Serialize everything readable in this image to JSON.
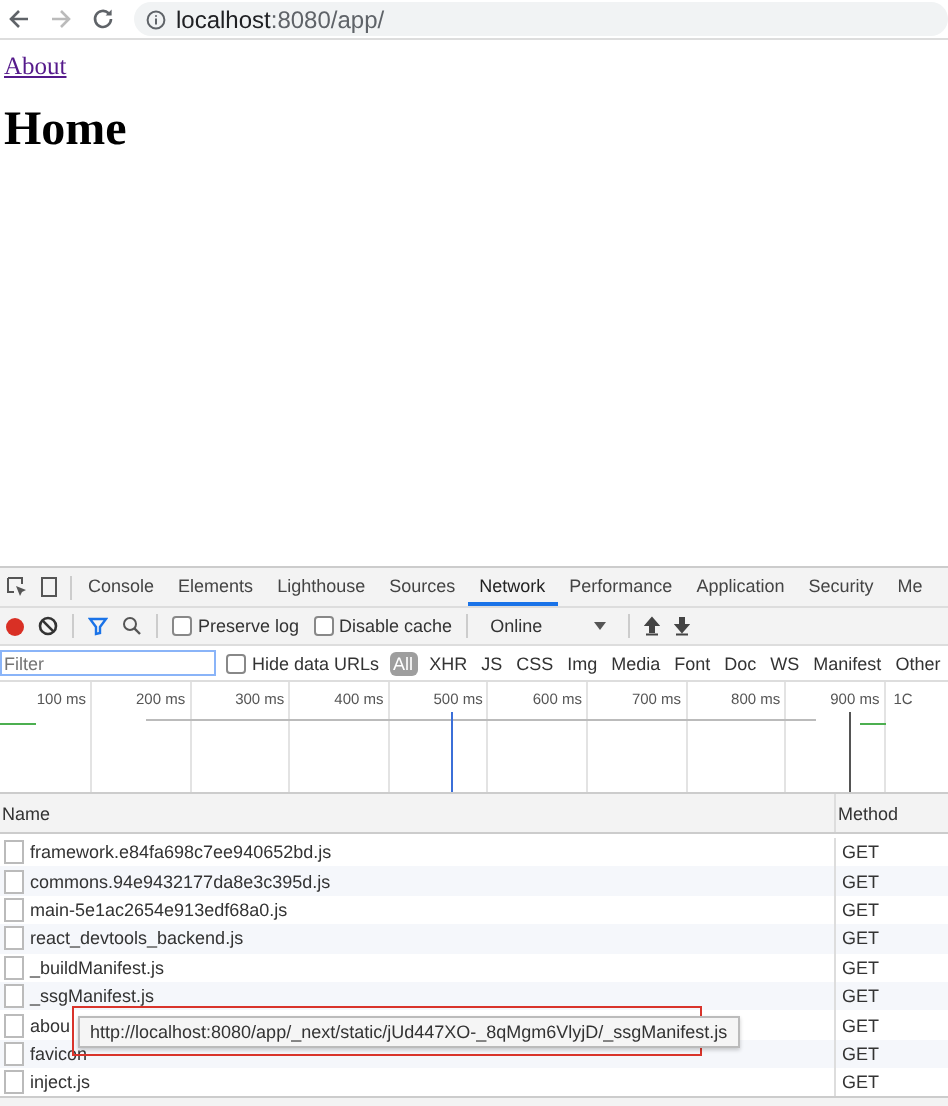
{
  "browser": {
    "url_host": "localhost",
    "url_rest": ":8080/app/"
  },
  "page": {
    "link": "About",
    "heading": "Home"
  },
  "devtools": {
    "tabs": [
      {
        "label": "Console",
        "selected": false
      },
      {
        "label": "Elements",
        "selected": false
      },
      {
        "label": "Lighthouse",
        "selected": false
      },
      {
        "label": "Sources",
        "selected": false
      },
      {
        "label": "Network",
        "selected": true
      },
      {
        "label": "Performance",
        "selected": false
      },
      {
        "label": "Application",
        "selected": false
      },
      {
        "label": "Security",
        "selected": false
      },
      {
        "label": "Me",
        "selected": false
      }
    ],
    "toolbar": {
      "recording": true,
      "preserve_log": {
        "label": "Preserve log",
        "checked": false
      },
      "disable_cache": {
        "label": "Disable cache",
        "checked": false
      },
      "throttling": "Online"
    },
    "filter": {
      "placeholder": "Filter",
      "hide_data_urls": {
        "label": "Hide data URLs",
        "checked": false
      },
      "types": [
        {
          "label": "All",
          "selected": true
        },
        {
          "label": "XHR",
          "selected": false
        },
        {
          "label": "JS",
          "selected": false
        },
        {
          "label": "CSS",
          "selected": false
        },
        {
          "label": "Img",
          "selected": false
        },
        {
          "label": "Media",
          "selected": false
        },
        {
          "label": "Font",
          "selected": false
        },
        {
          "label": "Doc",
          "selected": false
        },
        {
          "label": "WS",
          "selected": false
        },
        {
          "label": "Manifest",
          "selected": false
        },
        {
          "label": "Other",
          "selected": false
        }
      ]
    },
    "overview_ticks": [
      "100 ms",
      "200 ms",
      "300 ms",
      "400 ms",
      "500 ms",
      "600 ms",
      "700 ms",
      "800 ms",
      "900 ms",
      "1C"
    ],
    "table": {
      "columns": [
        "Name",
        "Method"
      ],
      "rows": [
        {
          "name": "framework.e84fa698c7ee940652bd.js",
          "method": "GET"
        },
        {
          "name": "commons.94e9432177da8e3c395d.js",
          "method": "GET"
        },
        {
          "name": "main-5e1ac2654e913edf68a0.js",
          "method": "GET"
        },
        {
          "name": "react_devtools_backend.js",
          "method": "GET"
        },
        {
          "name": "_buildManifest.js",
          "method": "GET"
        },
        {
          "name": "_ssgManifest.js",
          "method": "GET"
        },
        {
          "name": "abou",
          "method": "GET"
        },
        {
          "name": "favicon",
          "method": "GET"
        },
        {
          "name": "inject.js",
          "method": "GET"
        }
      ]
    },
    "tooltip": "http://localhost:8080/app/_next/static/jUd447XO-_8qMgm6VlyjD/_ssgManifest.js"
  }
}
